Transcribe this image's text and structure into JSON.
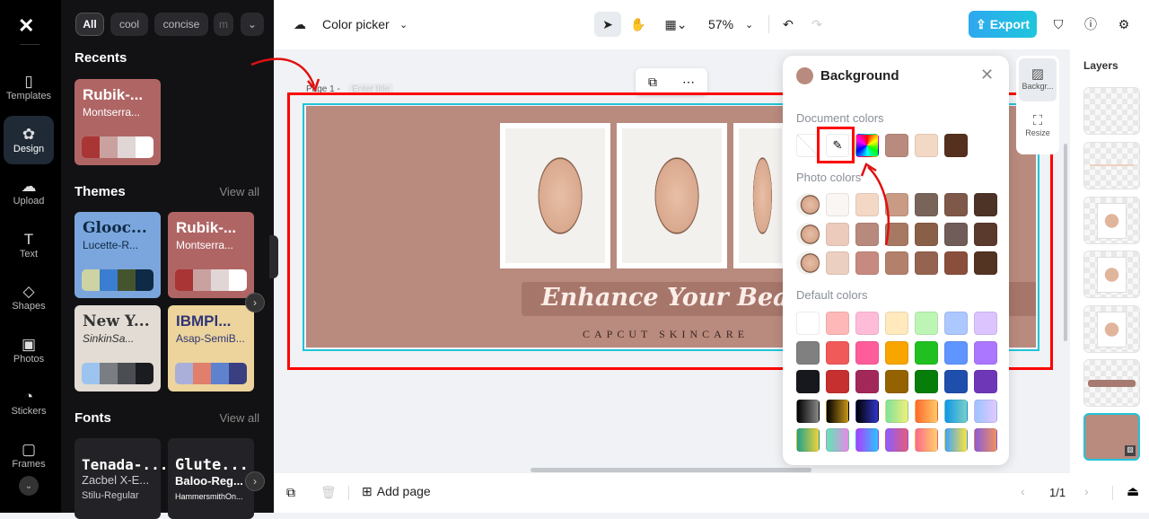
{
  "rail": {
    "items": [
      {
        "label": "Templates",
        "icon": "templates-icon"
      },
      {
        "label": "Design",
        "icon": "design-icon"
      },
      {
        "label": "Upload",
        "icon": "upload-icon"
      },
      {
        "label": "Text",
        "icon": "text-icon"
      },
      {
        "label": "Shapes",
        "icon": "shapes-icon"
      },
      {
        "label": "Photos",
        "icon": "photos-icon"
      },
      {
        "label": "Stickers",
        "icon": "stickers-icon"
      },
      {
        "label": "Frames",
        "icon": "frames-icon"
      }
    ]
  },
  "panel": {
    "chips": [
      "All",
      "cool",
      "concise",
      "m"
    ],
    "recents_title": "Recents",
    "recent": {
      "t1": "Rubik-...",
      "t2": "Montserra...",
      "colors": [
        "#a93535",
        "#c9a2a0",
        "#e0d6d5",
        "#ffffff"
      ],
      "bg": "#b06565"
    },
    "themes_title": "Themes",
    "themes_view_all": "View all",
    "themes": [
      {
        "t1": "Glooc...",
        "t2": "Lucette-R...",
        "bg": "#7ba6dd",
        "fg": "#0e2a44",
        "colors": [
          "#cdd3a3",
          "#3b7dd0",
          "#44552e",
          "#0e2a44"
        ]
      },
      {
        "t1": "Rubik-...",
        "t2": "Montserra...",
        "bg": "#b06565",
        "fg": "#ffffff",
        "colors": [
          "#a93535",
          "#c9a2a0",
          "#e0d6d5",
          "#ffffff"
        ]
      },
      {
        "t1": "New Y...",
        "t2": "SinkinSa...",
        "bg": "#e2dcd4",
        "fg": "#333333",
        "colors": [
          "#9cc4ee",
          "#7a7e82",
          "#4a4d52",
          "#1b1c1f"
        ]
      },
      {
        "t1": "IBMPl...",
        "t2": "Asap-SemiB...",
        "bg": "#ecd49c",
        "fg": "#2f3577",
        "colors": [
          "#a9afd9",
          "#e07f6b",
          "#5f82cf",
          "#3a3f82"
        ]
      }
    ],
    "fonts_title": "Fonts",
    "fonts_view_all": "View all",
    "fonts": [
      {
        "l1": "Tenada-...",
        "l2": "Zacbel X-E...",
        "l3": "Stilu-Regular"
      },
      {
        "l1": "Glute...",
        "l2": "Baloo-Reg...",
        "l3": "HammersmithOn..."
      }
    ]
  },
  "topbar": {
    "title": "Color picker",
    "zoom": "57%",
    "export": "Export"
  },
  "canvas": {
    "page_label": "Page 1 -",
    "page_title_placeholder": "Enter title",
    "headline": "Enhance Your Beauty Sk",
    "subline": "CAPCUT SKINCARE",
    "bg_color": "#b98a7e"
  },
  "popup": {
    "title": "Background",
    "current_color": "#b98a7e",
    "document_label": "Document colors",
    "document_colors": [
      "#b98a7e",
      "#f3d8c5",
      "#55301f"
    ],
    "photo_label": "Photo colors",
    "photo_rows": [
      [
        "#faf6f4",
        "#f3d8c5",
        "#c99a84",
        "#786459",
        "#7e5849",
        "#4d3326"
      ],
      [
        "#eccbbd",
        "#b8897d",
        "#a87962",
        "#8a5f47",
        "#705c58",
        "#5a3a2d"
      ],
      [
        "#ebcfc0",
        "#c78a80",
        "#b3806c",
        "#946450",
        "#8a4f3c",
        "#533322"
      ]
    ],
    "default_label": "Default colors",
    "default_rows": [
      [
        "#ffffff",
        "#ffb8b8",
        "#ffbcd9",
        "#ffe9bd",
        "#bdf5b5",
        "#adc8ff",
        "#dcc4ff"
      ],
      [
        "#808080",
        "#f05a59",
        "#ff5c9b",
        "#f8a500",
        "#20c020",
        "#5f95ff",
        "#ab77ff"
      ],
      [
        "#16181d",
        "#c6302e",
        "#a3285a",
        "#956200",
        "#087e0a",
        "#1f4fac",
        "#6e37b8"
      ]
    ],
    "gradients": [
      [
        "linear-gradient(90deg,#000,#888)",
        "linear-gradient(90deg,#000,#c8961a)",
        "linear-gradient(90deg,#000,#3236c8)",
        "linear-gradient(90deg,#7ee29b,#f1ee7a)",
        "linear-gradient(90deg,#ff6a2a,#ffc96a)",
        "linear-gradient(90deg,#1097e8,#78d0c6)",
        "linear-gradient(90deg,#9cc4ff,#e2c8ff)"
      ],
      [
        "linear-gradient(90deg,#1ea28a,#f1d23a)",
        "linear-gradient(90deg,#5ee6b4,#e58be6)",
        "linear-gradient(90deg,#b03cff,#2bc4ff)",
        "linear-gradient(90deg,#8c5cff,#e65c7a)",
        "linear-gradient(90deg,#ff6a8a,#ffd06a)",
        "linear-gradient(90deg,#3ea2ff,#ffe23a)",
        "linear-gradient(90deg,#8c5cd6,#f09060)"
      ]
    ]
  },
  "sidetabs": {
    "background": "Backgr...",
    "resize": "Resize"
  },
  "layers": {
    "title": "Layers"
  },
  "bottombar": {
    "add_page": "Add page",
    "page_counter": "1/1"
  }
}
